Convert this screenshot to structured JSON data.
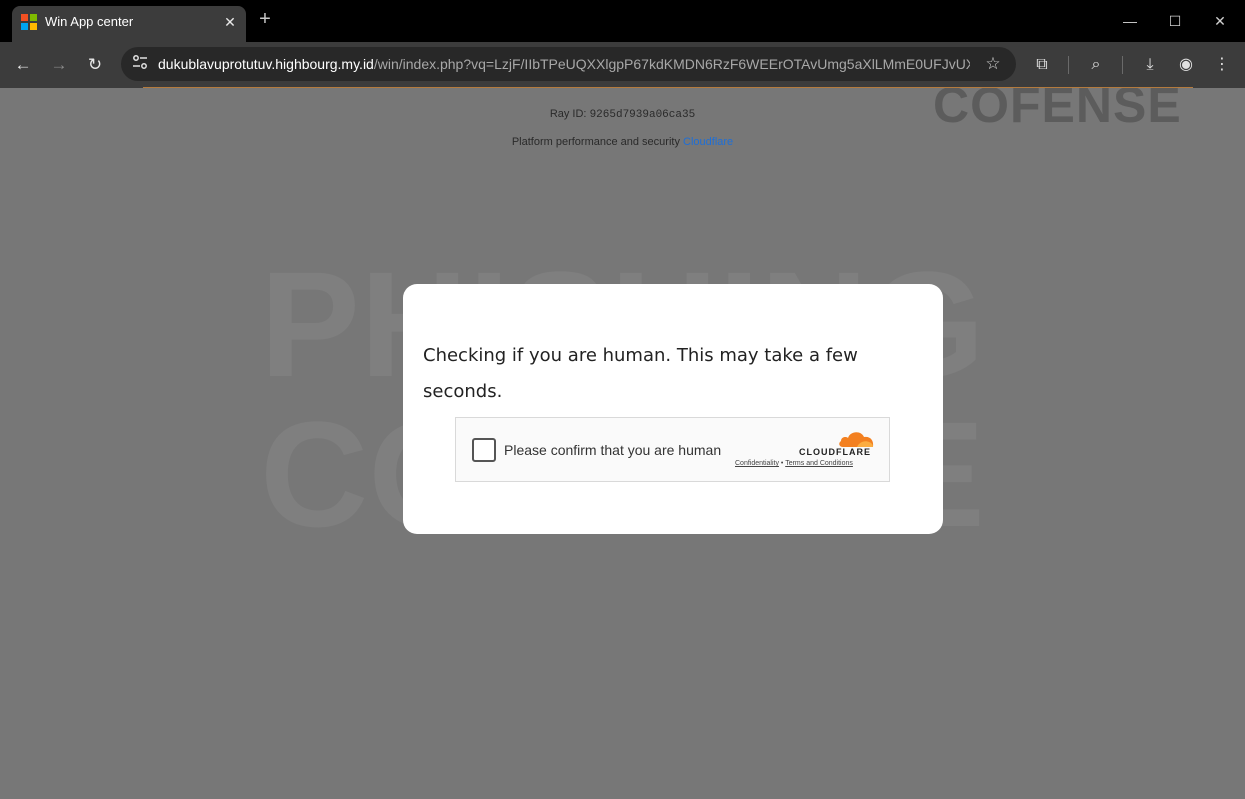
{
  "browser": {
    "tab": {
      "title": "Win App center",
      "close_glyph": "✕",
      "favicon_colors": [
        "#f25022",
        "#7fba00",
        "#00a4ef",
        "#ffb900"
      ]
    },
    "new_tab_glyph": "+",
    "window_controls": {
      "minimize": "—",
      "maximize": "☐",
      "close": "✕"
    },
    "nav": {
      "back": "←",
      "forward": "→",
      "reload": "↻"
    },
    "address": {
      "host": "dukublavuprotutuv.highbourg.my.id",
      "path": "/win/index.php?vq=LzjF/IIbTPeUQXXlgpP67kdKMDN6RzF6WEErOTAvUmg5aXlLMmE0UFJvUX..."
    },
    "icons": {
      "site_info": "site-settings-icon",
      "bookmark": "☆",
      "extensions": "⧉",
      "search_tab": "⌕",
      "download": "⤓",
      "profile": "◉",
      "menu": "⋮"
    }
  },
  "page": {
    "ray_id_label": "Ray ID:",
    "ray_id_value": "9265d7939a06ca35",
    "perf_text": "Platform performance and security",
    "perf_link": "Cloudflare",
    "watermark": {
      "corner": "COFENSE",
      "line1": "PHISHING",
      "line2": "COFENSE"
    }
  },
  "modal": {
    "message": "Checking if you are human. This may take a few seconds.",
    "widget": {
      "checkbox_label": "Please confirm that you are human",
      "brand": "CLOUDFLARE",
      "link_confidentiality": "Confidentiality",
      "link_separator": "•",
      "link_terms": "Terms and Conditions",
      "cloud_color": "#f38020"
    }
  }
}
